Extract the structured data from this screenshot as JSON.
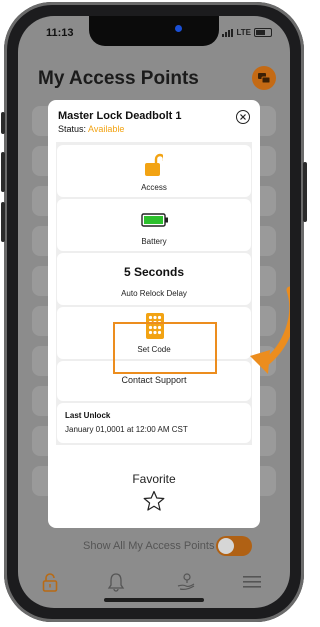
{
  "status_bar": {
    "time": "11:13",
    "network": "LTE"
  },
  "page": {
    "title": "My Access Points"
  },
  "modal": {
    "title": "Master Lock Deadbolt 1",
    "status_label": "Status:",
    "status_value": "Available",
    "access_label": "Access",
    "battery_label": "Battery",
    "relock_value": "5 Seconds",
    "relock_label": "Auto Relock Delay",
    "set_code_label": "Set Code",
    "contact_support_label": "Contact Support",
    "last_unlock_title": "Last Unlock",
    "last_unlock_value": "January 01,0001 at 12:00 AM CST",
    "favorite_label": "Favorite"
  },
  "footer": {
    "show_all_label": "Show All My Access Points",
    "show_all_toggle_on": true
  },
  "colors": {
    "accent": "#F2A313",
    "battery_green": "#2DC02D",
    "highlight": "#EC8D1E",
    "brand_dark": "#C46A14"
  },
  "icons": [
    "unlocked-padlock-icon",
    "battery-icon",
    "keypad-icon",
    "close-icon",
    "star-outline-icon",
    "lock-tab-icon",
    "bell-tab-icon",
    "hand-location-tab-icon",
    "menu-tab-icon",
    "chat-icon"
  ]
}
